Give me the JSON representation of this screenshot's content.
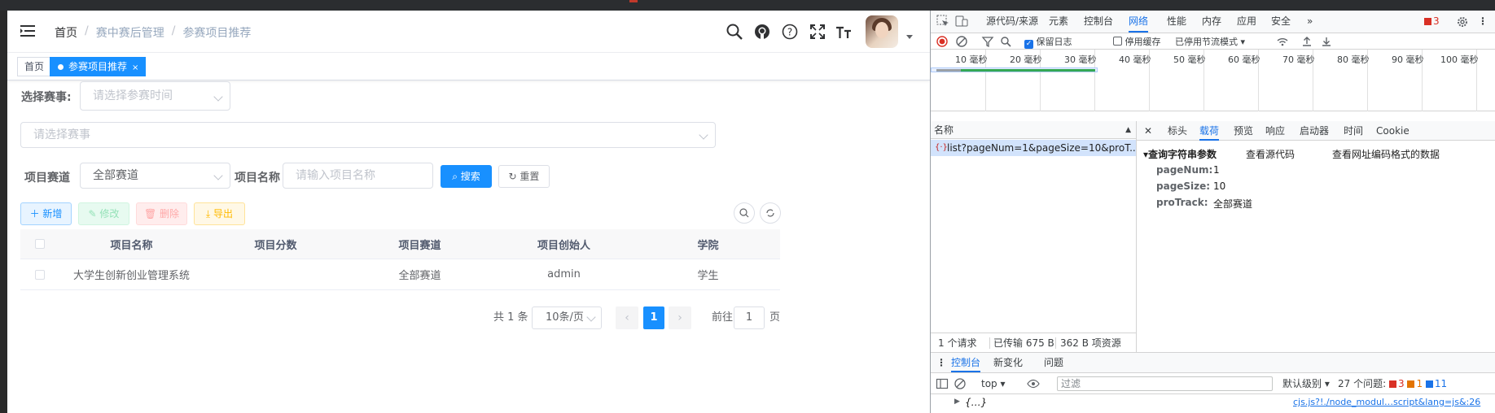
{
  "app": {
    "breadcrumb": [
      "首页",
      "赛中赛后管理",
      "参赛项目推荐"
    ],
    "breadcrumb_sep": "/",
    "tags": {
      "home": "首页",
      "active": "参赛项目推荐",
      "close": "×"
    },
    "icons": [
      "menu-icon",
      "search-icon",
      "github-icon",
      "question-icon",
      "fullscreen-icon",
      "font-size-icon",
      "avatar",
      "chevron-down-icon"
    ],
    "filters": {
      "event_label": "选择赛事:",
      "event_time_placeholder": "请选择参赛时间",
      "event_placeholder": "请选择赛事",
      "track_label": "项目赛道",
      "track_value": "全部赛道",
      "name_label": "项目名称",
      "name_placeholder": "请输入项目名称",
      "search_btn": "搜索",
      "reset_btn": "重置"
    },
    "toolbar": {
      "add": "新增",
      "edit": "修改",
      "delete": "删除",
      "export": "导出"
    },
    "table": {
      "columns": [
        "项目名称",
        "项目分数",
        "项目赛道",
        "项目创始人",
        "学院"
      ],
      "rows": [
        {
          "name": "大学生创新创业管理系统",
          "score": "",
          "track": "全部赛道",
          "founder": "admin",
          "college": "学生"
        }
      ]
    },
    "pagination": {
      "total": "共 1 条",
      "page_size": "10条/页",
      "prev": "‹",
      "current": "1",
      "next": "›",
      "goto": "前往",
      "goto_value": "1",
      "page_suffix": "页"
    }
  },
  "devtools": {
    "tabs": [
      "源代码/来源",
      "元素",
      "控制台",
      "网络",
      "性能",
      "内存",
      "应用",
      "安全",
      "»"
    ],
    "active_tab": "网络",
    "error_count": "3",
    "network_toolbar": {
      "preserve_log": "保留日志",
      "disable_cache": "停用缓存",
      "throttle": "已停用节流模式"
    },
    "timeline_ticks": [
      "10 毫秒",
      "20 毫秒",
      "30 毫秒",
      "40 毫秒",
      "50 毫秒",
      "60 毫秒",
      "70 毫秒",
      "80 毫秒",
      "90 毫秒",
      "100 毫秒"
    ],
    "name_header": "名称",
    "request": "list?pageNum=1&pageSize=10&proT...",
    "panel_tabs": [
      "标头",
      "载荷",
      "预览",
      "响应",
      "启动器",
      "时间",
      "Cookie"
    ],
    "active_panel_tab": "载荷",
    "payload": {
      "section": "▾查询字符串参数",
      "view_source": "查看源代码",
      "view_url_encoded": "查看网址编码格式的数据",
      "params": [
        {
          "key": "pageNum:",
          "value": "1"
        },
        {
          "key": "pageSize:",
          "value": "10"
        },
        {
          "key": "proTrack:",
          "value": "全部赛道"
        }
      ]
    },
    "status": {
      "requests": "1 个请求",
      "transferred": "已传输 675 B",
      "resources": "362 B 项资源"
    },
    "drawer_tabs": [
      "控制台",
      "新变化",
      "问题"
    ],
    "console": {
      "context": "top",
      "filter_placeholder": "过滤",
      "level": "默认级别",
      "issues": "27 个问题:",
      "issue_counts": [
        "3",
        "1",
        "11"
      ],
      "entry": "{…}",
      "source_link": "cjs.js?!./node_modul…script&lang=js&:26"
    }
  }
}
